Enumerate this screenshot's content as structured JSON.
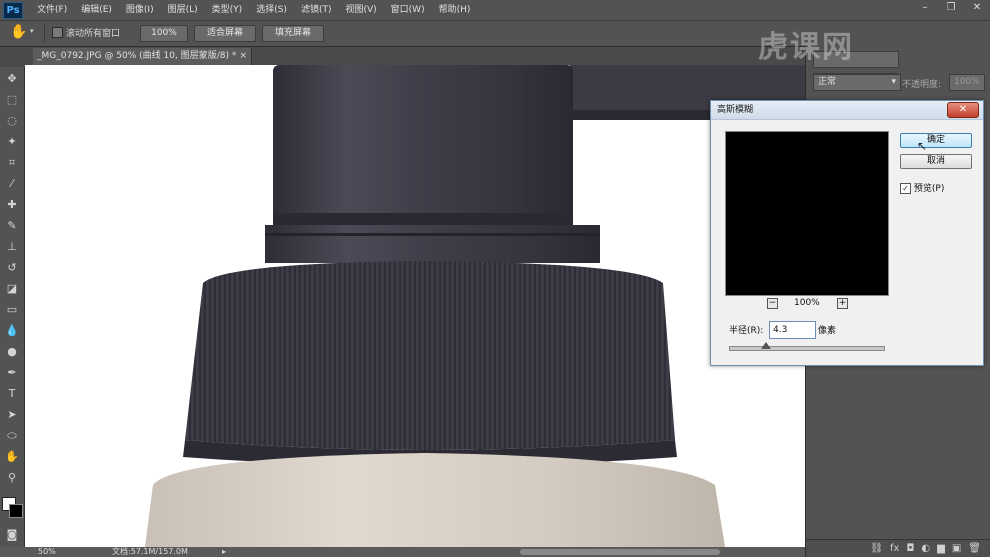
{
  "app": {
    "logo": "Ps"
  },
  "menu": [
    "文件(F)",
    "编辑(E)",
    "图像(I)",
    "图层(L)",
    "类型(Y)",
    "选择(S)",
    "滤镜(T)",
    "视图(V)",
    "窗口(W)",
    "帮助(H)"
  ],
  "options": {
    "scroll_all": "滚动所有窗口",
    "zoom_btn": "100%",
    "fit_screen": "适合屏幕",
    "fill_screen": "填充屏幕"
  },
  "document": {
    "tab": "_MG_0792.JPG @ 50% (曲线 10, 图层蒙版/8) *"
  },
  "panel": {
    "blend_mode": "正常",
    "opacity_label": "不透明度:",
    "opacity_value": "100%"
  },
  "status": {
    "zoom": "50%",
    "doc": "文档:57.1M/157.0M"
  },
  "dialog": {
    "title": "高斯模糊",
    "ok": "确定",
    "cancel": "取消",
    "preview_label": "预览(P)",
    "zoom_level": "100%",
    "radius_label": "半径(R):",
    "radius_value": "4.3",
    "radius_unit": "像素"
  },
  "watermark": "虎课网",
  "colors": {
    "cap": "#3e3c48",
    "bottle": "#d6cfc6",
    "ui_panel": "#535353"
  }
}
